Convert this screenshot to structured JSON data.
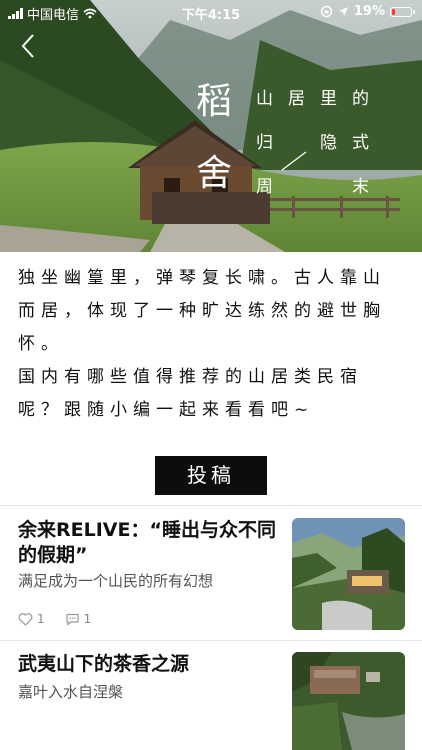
{
  "status_bar": {
    "carrier": "中国电信",
    "time": "下午4:15",
    "battery": "19%",
    "battery_level": 0.19
  },
  "hero": {
    "poem_big": [
      "稻",
      "舍"
    ],
    "poem_cols": [
      [
        "山",
        "居",
        "里",
        "的"
      ],
      [
        "归",
        "隐",
        "式"
      ],
      [
        "周",
        "末"
      ]
    ]
  },
  "intro": {
    "paragraph_1": "独坐幽篁里，弹琴复长啸。古人靠山而居，体现了一种旷达练然的避世胸怀。",
    "paragraph_2": "国内有哪些值得推荐的山居类民宿呢？跟随小编一起来看看吧~"
  },
  "submit_button": "投稿",
  "articles": [
    {
      "title": "余来RELIVE：“睡出与众不同的假期”",
      "subtitle": "满足成为一个山民的所有幻想",
      "likes": "1",
      "comments": "1"
    },
    {
      "title": "武夷山下的茶香之源",
      "subtitle": "嘉叶入水自涅槃"
    }
  ],
  "colors": {
    "button_bg": "#0d0d0d",
    "battery_low": "#ff3b30"
  }
}
